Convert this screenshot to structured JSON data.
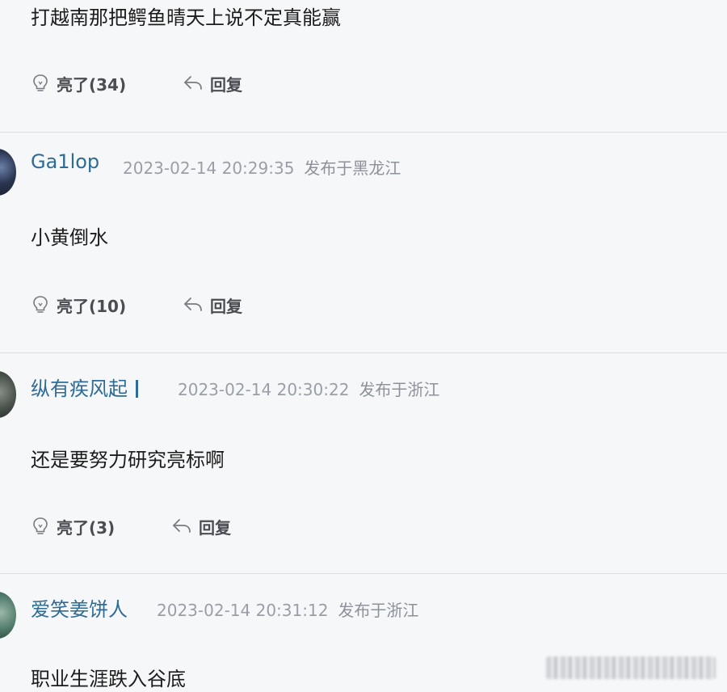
{
  "comments": [
    {
      "content": "打越南那把鳄鱼晴天上说不定真能赢",
      "like_label": "亮了(34)",
      "reply_label": "回复"
    },
    {
      "username": "Ga1lop",
      "timestamp": "2023-02-14 20:29:35",
      "location": "发布于黑龙江",
      "content": "小黄倒水",
      "like_label": "亮了(10)",
      "reply_label": "回复"
    },
    {
      "username": "纵有疾风起",
      "timestamp": "2023-02-14 20:30:22",
      "location": "发布于浙江",
      "content": "还是要努力研究亮标啊",
      "like_label": "亮了(3)",
      "reply_label": "回复"
    },
    {
      "username": "爱笑姜饼人",
      "timestamp": "2023-02-14 20:31:12",
      "location": "发布于浙江",
      "content": "职业生涯跌入谷底"
    }
  ],
  "icons": {
    "like": "lightbulb-icon",
    "reply": "reply-arrow-icon"
  },
  "colors": {
    "background": "#f6f7f9",
    "username": "#2e6b95",
    "meta": "#9a9ea6",
    "divider": "#dcdee3",
    "action_text": "#4a4d52"
  }
}
